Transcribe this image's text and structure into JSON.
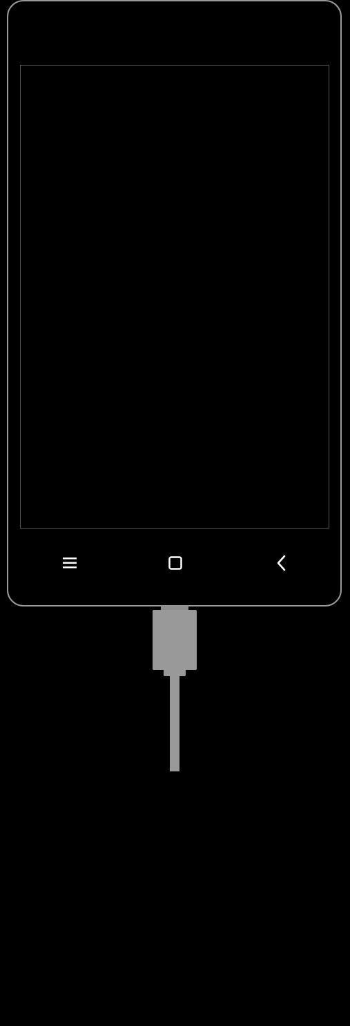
{
  "device": {
    "screen_state": "off",
    "frame_color": "#9a9a9a",
    "screen_border_color": "#555555",
    "background_color": "#000000"
  },
  "navigation_bar": {
    "buttons": [
      {
        "name": "menu",
        "icon": "menu-icon"
      },
      {
        "name": "home",
        "icon": "home-square-icon"
      },
      {
        "name": "back",
        "icon": "chevron-left-icon"
      }
    ],
    "icon_color": "#ffffff"
  },
  "charging_cable": {
    "connected": true,
    "color": "#999999"
  }
}
